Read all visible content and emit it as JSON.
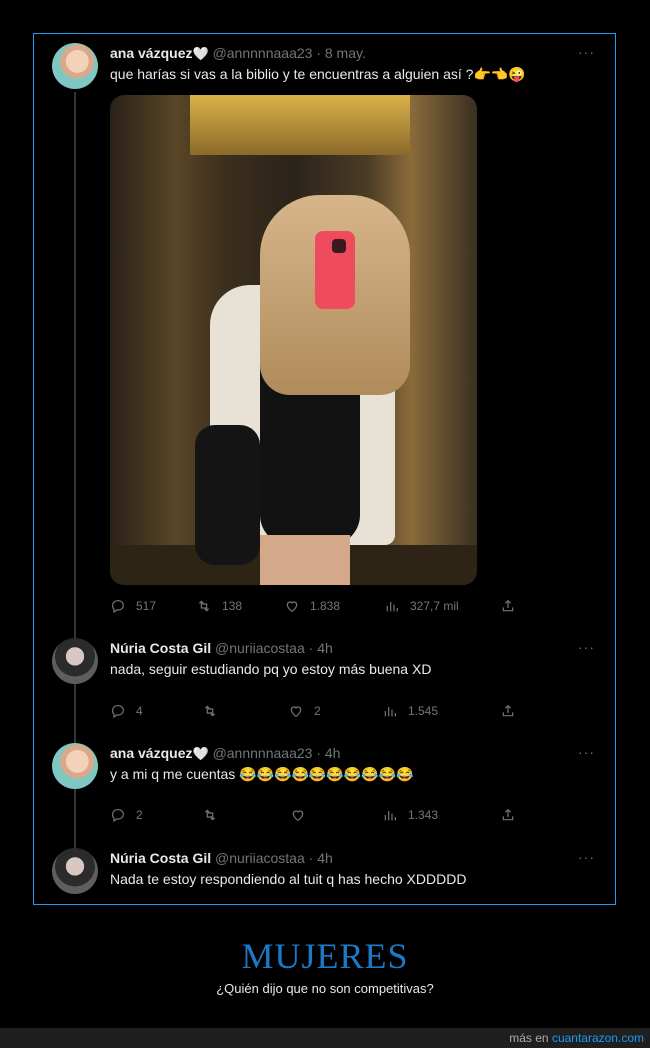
{
  "tweets": [
    {
      "name": "ana vázquez",
      "handle": "@annnnnaaa23",
      "time": "8 may.",
      "text": "que harías si vas a la biblio y te encuentras a alguien así ?👉👈😜",
      "replies": "517",
      "retweets": "138",
      "likes": "1.838",
      "views": "327,7 mil"
    },
    {
      "name": "Núria Costa Gil",
      "handle": "@nuriiacostaa",
      "time": "4h",
      "text": "nada, seguir estudiando pq yo estoy más buena XD",
      "replies": "4",
      "retweets": "",
      "likes": "2",
      "views": "1.545"
    },
    {
      "name": "ana vázquez",
      "handle": "@annnnnaaa23",
      "time": "4h",
      "text": "y a mi q me cuentas 😂😂😂😂😂😂😂😂😂😂",
      "replies": "2",
      "retweets": "",
      "likes": "",
      "views": "1.343"
    },
    {
      "name": "Núria Costa Gil",
      "handle": "@nuriiacostaa",
      "time": "4h",
      "text": "Nada te estoy respondiendo al tuit q has hecho XDDDDD"
    }
  ],
  "heart_emoji": "🤍",
  "dot": "·",
  "more_label": "···",
  "footer": {
    "title": "MUJERES",
    "subtitle": "¿Quién dijo que no son competitivas?",
    "credit_prefix": "más en",
    "credit_link": "cuantarazon.com"
  },
  "colors": {
    "accent": "#1d9bf0",
    "footer_title": "#1d79c8",
    "muted": "#71767b"
  }
}
